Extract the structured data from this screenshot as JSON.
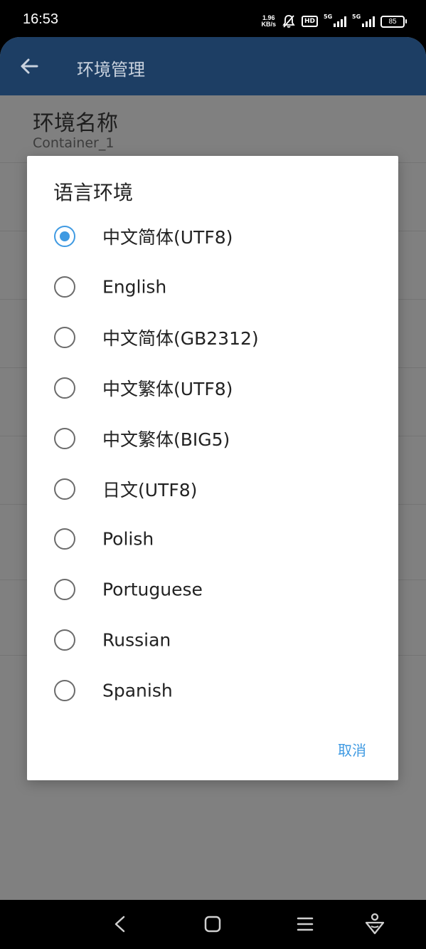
{
  "status_bar": {
    "time": "16:53",
    "net_speed_value": "1.96",
    "net_speed_unit": "KB/s",
    "hd_label": "HD",
    "sim1_label": "5G",
    "sim2_label": "5G",
    "battery": "85"
  },
  "app_bar": {
    "title": "环境管理"
  },
  "background_item": {
    "title": "环境名称",
    "value": "Container_1"
  },
  "dialog": {
    "title": "语言环境",
    "options": [
      {
        "label": "中文简体(UTF8)",
        "selected": true
      },
      {
        "label": "English",
        "selected": false
      },
      {
        "label": "中文简体(GB2312)",
        "selected": false
      },
      {
        "label": "中文繁体(UTF8)",
        "selected": false
      },
      {
        "label": "中文繁体(BIG5)",
        "selected": false
      },
      {
        "label": "日文(UTF8)",
        "selected": false
      },
      {
        "label": "Polish",
        "selected": false
      },
      {
        "label": "Portuguese",
        "selected": false
      },
      {
        "label": "Russian",
        "selected": false
      },
      {
        "label": "Spanish",
        "selected": false
      }
    ],
    "cancel_label": "取消"
  },
  "colors": {
    "accent": "#3f9ae2",
    "app_bar": "#1d3e64"
  }
}
